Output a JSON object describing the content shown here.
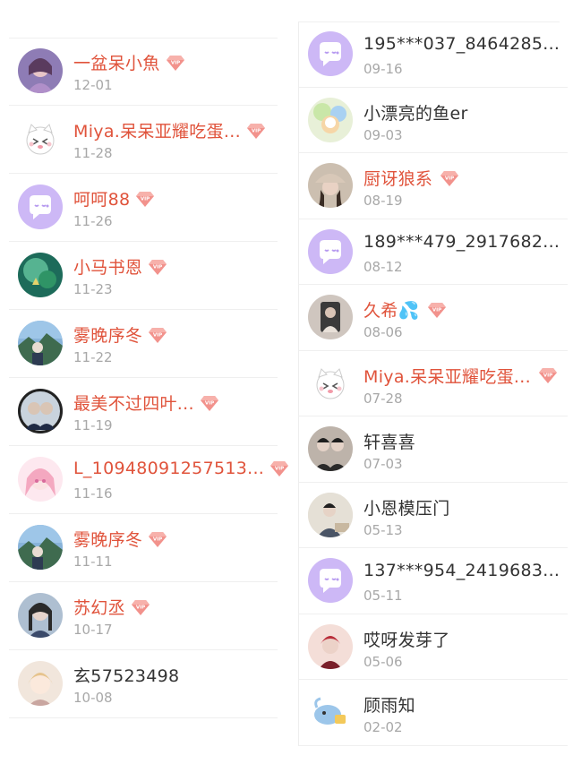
{
  "colors": {
    "vip_name": "#e0533b",
    "normal_name": "#333333",
    "date": "#a8a8a8",
    "vip_badge": "#f2928c"
  },
  "left": [
    {
      "name": "一盆呆小魚",
      "date": "12-01",
      "vip": true,
      "avatar": "photo-girl-purple"
    },
    {
      "name": "Miya.呆呆亚耀吃蛋...",
      "date": "11-28",
      "vip": true,
      "avatar": "cartoon-cat"
    },
    {
      "name": "呵呵88",
      "date": "11-26",
      "vip": true,
      "avatar": "default-chat"
    },
    {
      "name": "小马书恩",
      "date": "11-23",
      "vip": true,
      "avatar": "photo-green"
    },
    {
      "name": "雾晚序冬",
      "date": "11-22",
      "vip": true,
      "avatar": "photo-landscape"
    },
    {
      "name": "最美不过四叶...",
      "date": "11-19",
      "vip": true,
      "avatar": "photo-boys-ring"
    },
    {
      "name": "L_10948091257513...",
      "date": "11-16",
      "vip": true,
      "avatar": "anime-pink"
    },
    {
      "name": "雾晚序冬",
      "date": "11-11",
      "vip": true,
      "avatar": "photo-landscape"
    },
    {
      "name": "苏幻丞",
      "date": "10-17",
      "vip": true,
      "avatar": "photo-girl-dark"
    },
    {
      "name": "玄57523498",
      "date": "10-08",
      "vip": false,
      "avatar": "anime-blonde"
    }
  ],
  "right": [
    {
      "name": "195***037_8464285...",
      "date": "09-16",
      "vip": false,
      "avatar": "default-chat"
    },
    {
      "name": "小漂亮的鱼er",
      "date": "09-03",
      "vip": false,
      "avatar": "photo-colorful"
    },
    {
      "name": "厨讶狼系",
      "date": "08-19",
      "vip": true,
      "avatar": "photo-girl-hat"
    },
    {
      "name": "189***479_2917682...",
      "date": "08-12",
      "vip": false,
      "avatar": "default-chat"
    },
    {
      "name": "久希💦",
      "date": "08-06",
      "vip": true,
      "avatar": "photo-mirror"
    },
    {
      "name": "Miya.呆呆亚耀吃蛋...",
      "date": "07-28",
      "vip": true,
      "avatar": "cartoon-cat"
    },
    {
      "name": "轩喜喜",
      "date": "07-03",
      "vip": false,
      "avatar": "photo-boys-two"
    },
    {
      "name": "小恩模压门",
      "date": "05-13",
      "vip": false,
      "avatar": "photo-boy-study"
    },
    {
      "name": "137***954_2419683...",
      "date": "05-11",
      "vip": false,
      "avatar": "default-chat"
    },
    {
      "name": "哎呀发芽了",
      "date": "05-06",
      "vip": false,
      "avatar": "photo-red"
    },
    {
      "name": "顾雨知",
      "date": "02-02",
      "vip": false,
      "avatar": "cartoon-whale"
    }
  ]
}
